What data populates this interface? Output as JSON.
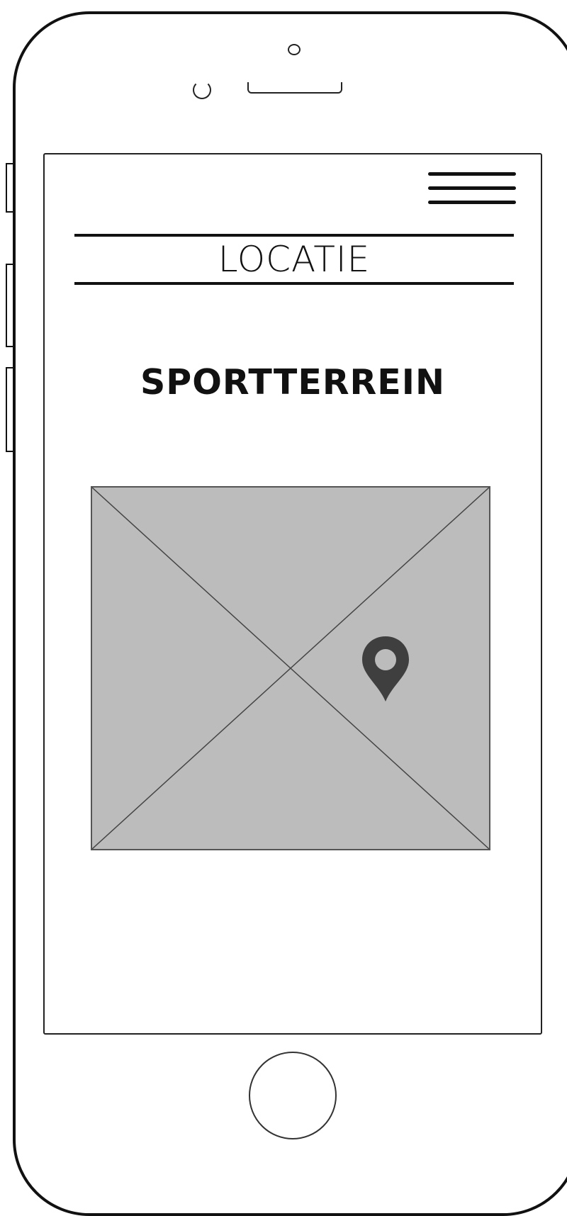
{
  "header": {
    "menu_icon": "hamburger-menu-icon",
    "title": "LOCATIE"
  },
  "main": {
    "location_name": "SPORTTERREIN",
    "map": {
      "placeholder_icon": "image-placeholder-icon",
      "pin_icon": "map-pin-icon",
      "pin_color": "#3f3f3f",
      "background_color": "#bcbcbc"
    }
  },
  "device": {
    "home_button_icon": "home-button-icon"
  }
}
